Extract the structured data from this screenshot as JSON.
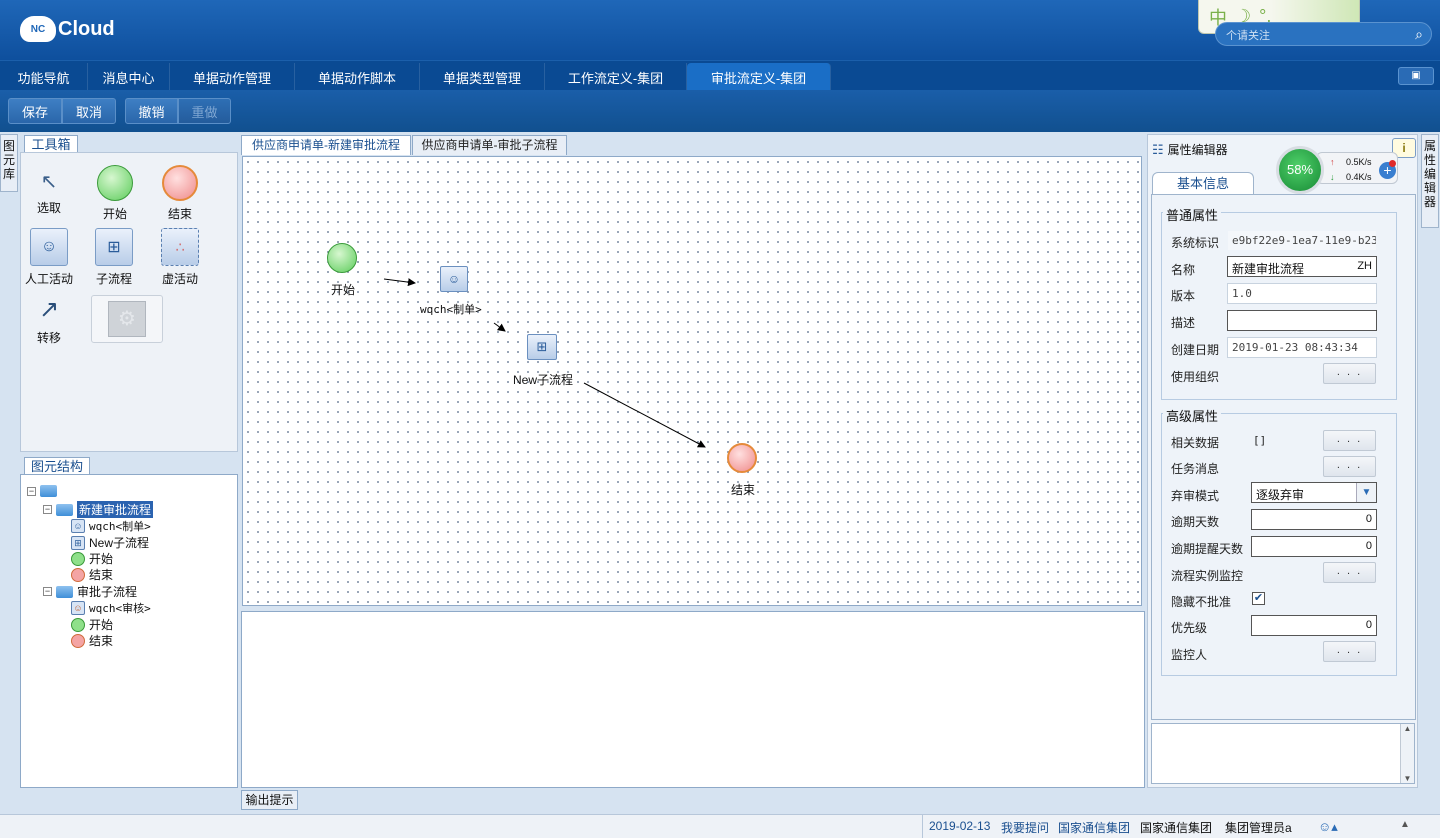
{
  "header": {
    "logo_badge": "NC",
    "logo_text": "Cloud",
    "search_placeholder": "个请关注",
    "ime": {
      "text": "中"
    }
  },
  "main_tabs": [
    {
      "label": "功能导航"
    },
    {
      "label": "消息中心"
    },
    {
      "label": "单据动作管理"
    },
    {
      "label": "单据动作脚本"
    },
    {
      "label": "单据类型管理"
    },
    {
      "label": "工作流定义-集团"
    },
    {
      "label": "审批流定义-集团",
      "active": true
    }
  ],
  "toolbar": {
    "save": "保存",
    "cancel": "取消",
    "undo": "撤销",
    "redo": "重做"
  },
  "left_strip": "图元库",
  "right_strip": "属性编辑器",
  "toolbox": {
    "title": "工具箱",
    "tools": {
      "select": "选取",
      "start": "开始",
      "end": "结束",
      "manual": "人工活动",
      "subflow": "子流程",
      "virtual": "虚活动",
      "transfer": "转移"
    }
  },
  "structure": {
    "title": "图元结构",
    "flow1": {
      "name": "新建审批流程",
      "items": [
        "wqch<制单>",
        "New子流程",
        "开始",
        "结束"
      ]
    },
    "flow2": {
      "name": "审批子流程",
      "items": [
        "wqch<审核>",
        "开始",
        "结束"
      ]
    }
  },
  "doc_tabs": [
    "供应商申请单-新建审批流程",
    "供应商申请单-审批子流程"
  ],
  "canvas": {
    "start_label": "开始",
    "task_label": "wqch<制单>",
    "subflow_label": "New子流程",
    "end_label": "结束"
  },
  "output_tab": "输出提示",
  "properties": {
    "title": "属性编辑器",
    "tab": "基本信息",
    "network": {
      "percent": "58%",
      "up": "0.5K/s",
      "down": "0.4K/s"
    },
    "general": {
      "title": "普通属性",
      "id_label": "系统标识",
      "id_value": "e9bf22e9-1ea7-11e9-b239-5",
      "name_label": "名称",
      "name_value": "新建审批流程",
      "name_suffix": "ZH",
      "version_label": "版本",
      "version_value": "1.0",
      "desc_label": "描述",
      "desc_value": "",
      "date_label": "创建日期",
      "date_value": "2019-01-23 08:43:34",
      "org_label": "使用组织"
    },
    "advanced": {
      "title": "高级属性",
      "related_label": "相关数据",
      "related_value": "[]",
      "task_msg_label": "任务消息",
      "abandon_label": "弃审模式",
      "abandon_value": "逐级弃审",
      "overdue_label": "逾期天数",
      "overdue_value": "0",
      "remind_label": "逾期提醒天数",
      "remind_value": "0",
      "monitor_label": "流程实例监控",
      "hide_label": "隐藏不批准",
      "hide_checked": true,
      "priority_label": "优先级",
      "priority_value": "0",
      "monitor_user_label": "监控人"
    },
    "dots": ". . ."
  },
  "status": {
    "date": "2019-02-13",
    "ask": "我要提问",
    "group1": "国家通信集团",
    "group2": "国家通信集团",
    "user": "集团管理员a"
  }
}
